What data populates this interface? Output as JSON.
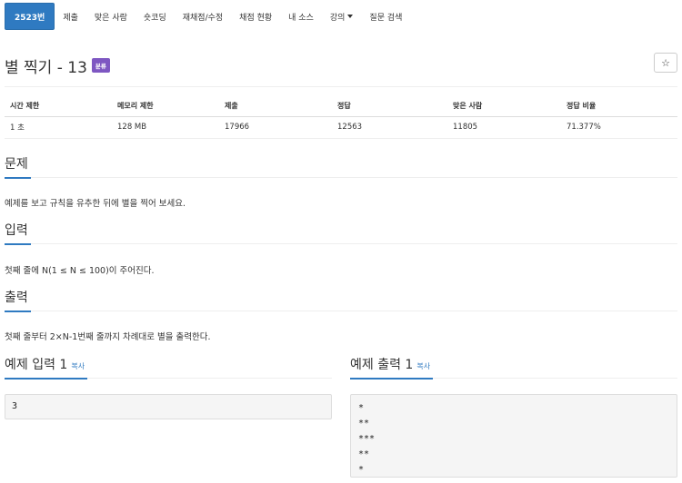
{
  "nav": {
    "items": [
      {
        "label": "2523번",
        "active": true
      },
      {
        "label": "제출"
      },
      {
        "label": "맞은 사람"
      },
      {
        "label": "숏코딩"
      },
      {
        "label": "재채점/수정"
      },
      {
        "label": "채점 현황"
      },
      {
        "label": "내 소스"
      },
      {
        "label": "강의"
      },
      {
        "label": "질문 검색"
      }
    ]
  },
  "problem": {
    "title": "별 찍기 - 13",
    "tag": "분류",
    "star_icon": "☆"
  },
  "info_table": {
    "headers": [
      "시간 제한",
      "메모리 제한",
      "제출",
      "정답",
      "맞은 사람",
      "정답 비율"
    ],
    "values": [
      "1 초",
      "128 MB",
      "17966",
      "12563",
      "11805",
      "71.377%"
    ]
  },
  "sections": {
    "problem": {
      "title": "문제",
      "text": "예제를 보고 규칙을 유추한 뒤에 별을 찍어 보세요."
    },
    "input": {
      "title": "입력",
      "text": "첫째 줄에 N(1 ≤ N ≤ 100)이 주어진다."
    },
    "output": {
      "title": "출력",
      "text": "첫째 줄부터 2×N-1번째 줄까지 차례대로 별을 출력한다."
    }
  },
  "samples": {
    "input": {
      "title": "예제 입력 1",
      "copy": "복사",
      "content": "3"
    },
    "output": {
      "title": "예제 출력 1",
      "copy": "복사",
      "content": "*\n**\n***\n**\n*"
    }
  },
  "colors": {
    "accent": "#2f7ac1",
    "tag": "#7e57c2"
  }
}
